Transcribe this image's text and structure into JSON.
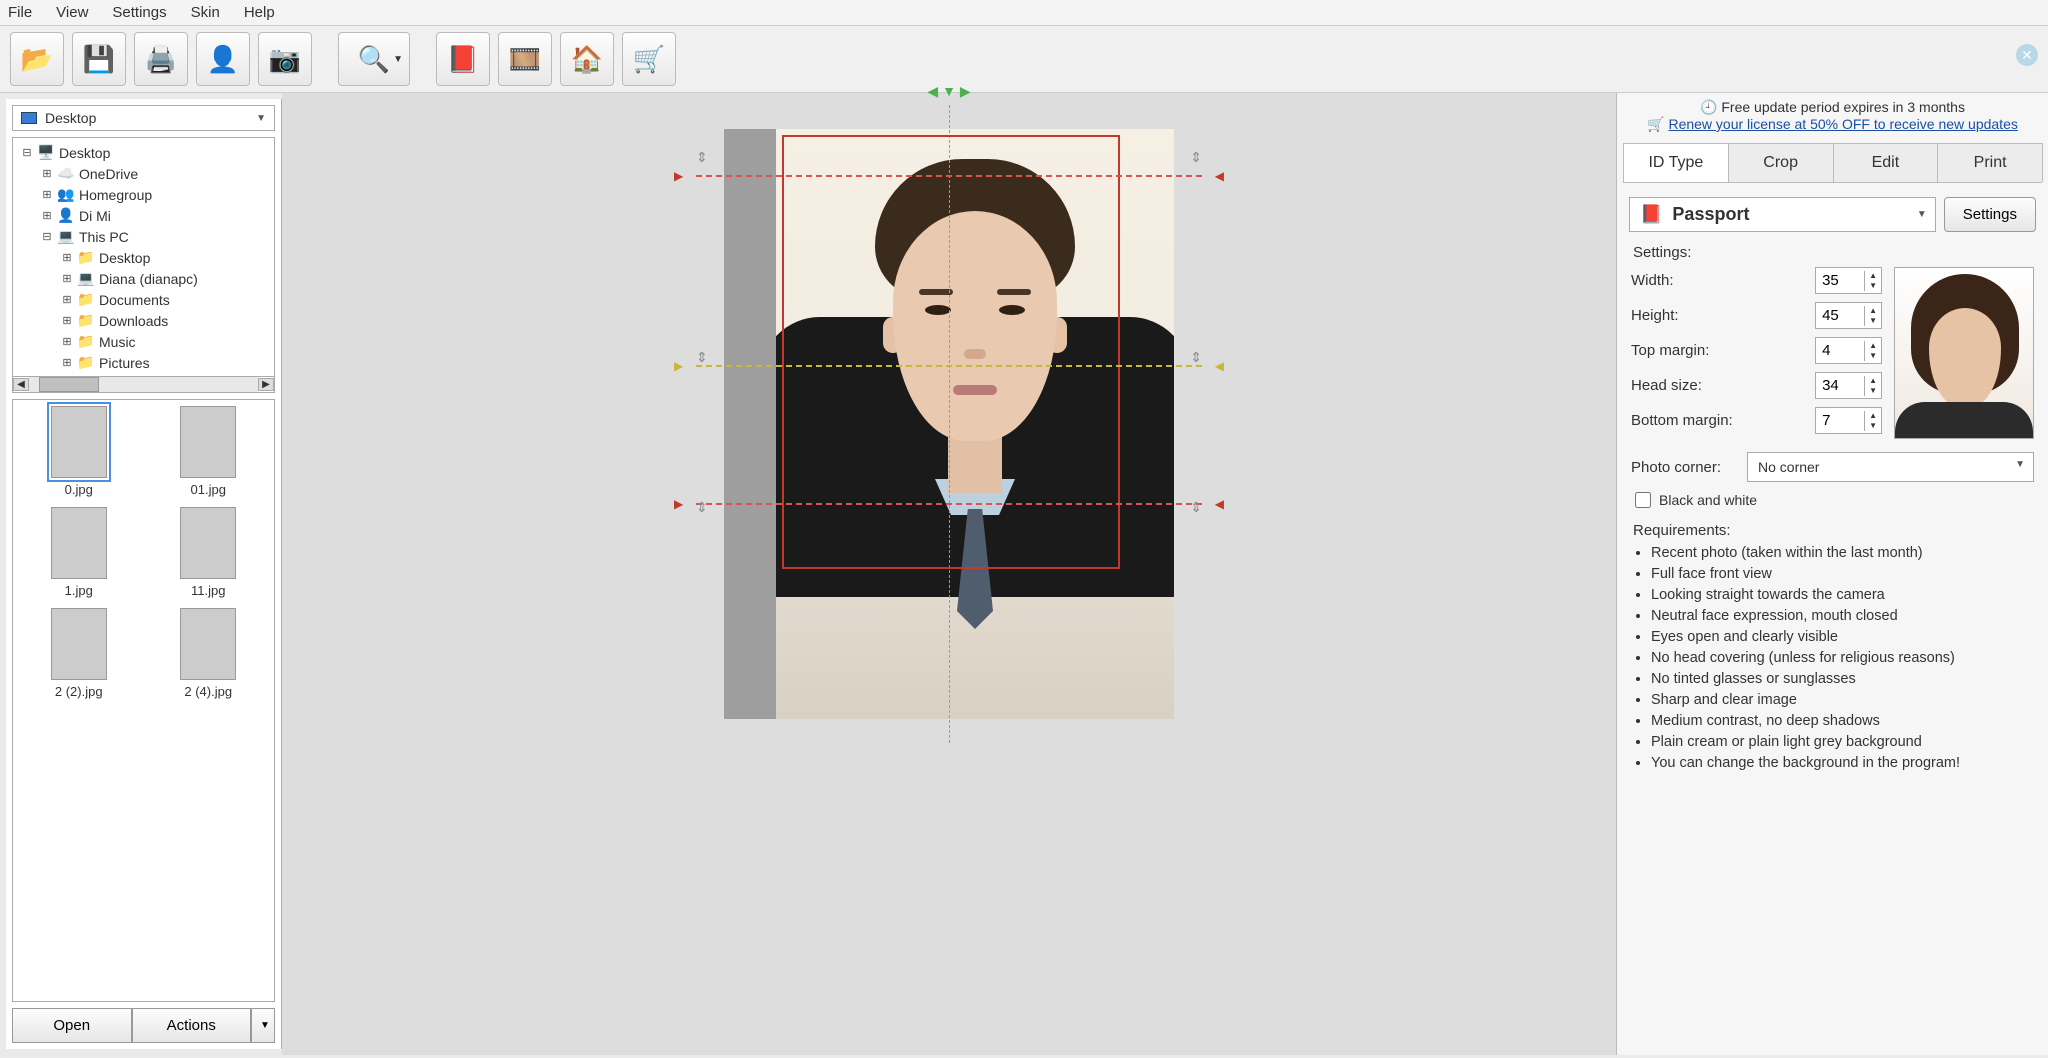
{
  "menu": {
    "items": [
      "File",
      "View",
      "Settings",
      "Skin",
      "Help"
    ]
  },
  "toolbar": {
    "buttons": [
      {
        "name": "open-folder-button",
        "glyph": "📂"
      },
      {
        "name": "save-button",
        "glyph": "💾"
      },
      {
        "name": "print-button",
        "glyph": "🖨️"
      },
      {
        "name": "person-button",
        "glyph": "👤"
      },
      {
        "name": "camera-button",
        "glyph": "📷"
      },
      {
        "name": "zoom-button",
        "glyph": "🔍",
        "drop": true
      },
      {
        "name": "help-button",
        "glyph": "📕"
      },
      {
        "name": "reel-button",
        "glyph": "🎞️"
      },
      {
        "name": "home-button",
        "glyph": "🏠"
      },
      {
        "name": "cart-button",
        "glyph": "🛒"
      }
    ],
    "separators_after": [
      4,
      5
    ]
  },
  "notice": {
    "line1": "Free update period expires in 3 months",
    "line2": "Renew your license at 50% OFF to receive new updates"
  },
  "left": {
    "location": "Desktop",
    "tree": [
      {
        "indent": 0,
        "toggle": "-",
        "icon": "🖥️",
        "label": "Desktop"
      },
      {
        "indent": 1,
        "toggle": "+",
        "icon": "☁️",
        "label": "OneDrive"
      },
      {
        "indent": 1,
        "toggle": "+",
        "icon": "👥",
        "label": "Homegroup"
      },
      {
        "indent": 1,
        "toggle": "+",
        "icon": "👤",
        "label": "Di Mi"
      },
      {
        "indent": 1,
        "toggle": "-",
        "icon": "💻",
        "label": "This PC"
      },
      {
        "indent": 2,
        "toggle": "+",
        "icon": "📁",
        "label": "Desktop"
      },
      {
        "indent": 2,
        "toggle": "+",
        "icon": "💻",
        "label": "Diana (dianapc)"
      },
      {
        "indent": 2,
        "toggle": "+",
        "icon": "📁",
        "label": "Documents"
      },
      {
        "indent": 2,
        "toggle": "+",
        "icon": "📁",
        "label": "Downloads"
      },
      {
        "indent": 2,
        "toggle": "+",
        "icon": "📁",
        "label": "Music"
      },
      {
        "indent": 2,
        "toggle": "+",
        "icon": "📁",
        "label": "Pictures"
      }
    ],
    "thumbs": [
      {
        "label": "0.jpg",
        "selected": true
      },
      {
        "label": "01.jpg"
      },
      {
        "label": "1.jpg"
      },
      {
        "label": "11.jpg"
      },
      {
        "label": "2 (2).jpg"
      },
      {
        "label": "2 (4).jpg"
      }
    ],
    "open_label": "Open",
    "actions_label": "Actions"
  },
  "right": {
    "tabs": [
      "ID Type",
      "Crop",
      "Edit",
      "Print"
    ],
    "active_tab": 0,
    "id_type": "Passport",
    "settings_button": "Settings",
    "settings_label": "Settings:",
    "fields": {
      "width": {
        "label": "Width:",
        "value": "35"
      },
      "height": {
        "label": "Height:",
        "value": "45"
      },
      "top_margin": {
        "label": "Top margin:",
        "value": "4"
      },
      "head_size": {
        "label": "Head size:",
        "value": "34"
      },
      "bottom_margin": {
        "label": "Bottom margin:",
        "value": "7"
      }
    },
    "corner": {
      "label": "Photo corner:",
      "value": "No corner"
    },
    "bw_label": "Black and white",
    "requirements_label": "Requirements:",
    "requirements": [
      "Recent photo (taken within the last month)",
      "Full face front view",
      "Looking straight towards the camera",
      "Neutral face expression, mouth closed",
      "Eyes open and clearly visible",
      "No head covering (unless for religious reasons)",
      "No tinted glasses or sunglasses",
      "Sharp and clear image",
      "Medium contrast, no deep shadows",
      "Plain cream or plain light grey background",
      "You can change the background in the program!"
    ]
  }
}
